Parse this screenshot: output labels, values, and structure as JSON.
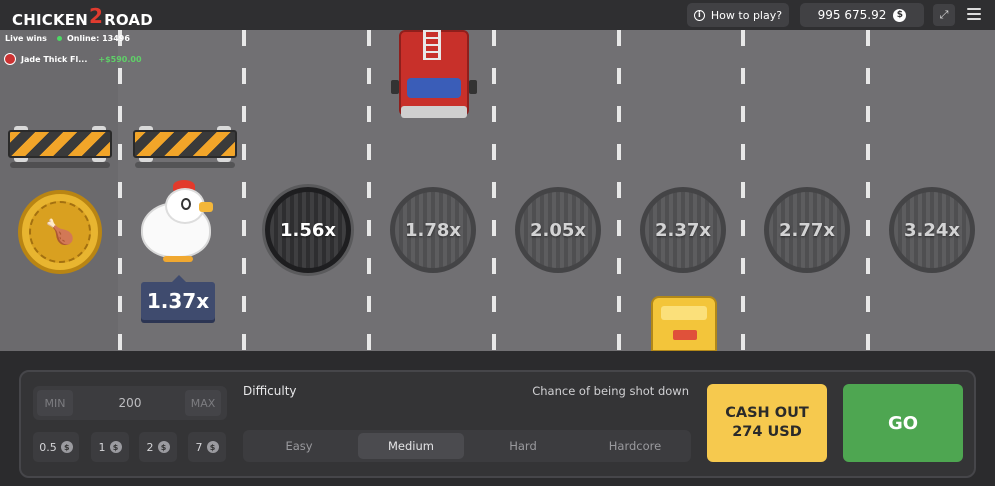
{
  "header": {
    "logo_left": "CHICKEN",
    "logo_mid": "2",
    "logo_right": "ROAD",
    "how_to_play": "How to play?",
    "balance": "995 675.92",
    "currency_symbol": "$"
  },
  "live": {
    "label": "Live wins",
    "online": "Online: 13496",
    "recent_win": {
      "player": "Jade Thick Fl...",
      "amount": "+$590.00"
    }
  },
  "game": {
    "current_multiplier": "1.37x",
    "lane_multipliers": [
      "1.56x",
      "1.78x",
      "2.05x",
      "2.37x",
      "2.77x",
      "3.24x"
    ]
  },
  "controls": {
    "min_label": "MIN",
    "max_label": "MAX",
    "bet_value": "200",
    "quick_bets": [
      "0.5",
      "1",
      "2",
      "7"
    ],
    "difficulty_label": "Difficulty",
    "chance_label": "Chance of being shot down",
    "difficulty_options": [
      "Easy",
      "Medium",
      "Hard",
      "Hardcore"
    ],
    "selected_difficulty": "Medium",
    "cashout_line1": "CASH OUT",
    "cashout_line2": "274 USD",
    "go_label": "GO"
  },
  "colors": {
    "road": "#717073",
    "cashout": "#f6c94e",
    "go": "#4ea651",
    "accent_red": "#e03b2f"
  },
  "icons": [
    "info-icon",
    "coin-icon",
    "fullscreen-icon",
    "menu-icon"
  ]
}
